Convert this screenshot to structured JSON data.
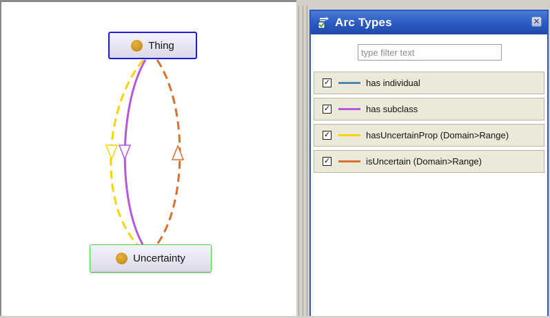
{
  "graph": {
    "nodes": {
      "thing": {
        "label": "Thing",
        "icon": "class-circle-icon"
      },
      "uncertainty": {
        "label": "Uncertainty",
        "icon": "class-circle-icon"
      }
    },
    "colors": {
      "node_dot": "#d4a029",
      "thing_border": "#1a1ad6",
      "uncertainty_border": "#4fd04f"
    }
  },
  "arc_panel": {
    "title": "Arc Types",
    "title_icon": "arc-types-icon",
    "close_icon": "close-icon",
    "filter_placeholder": "type filter text",
    "header_color": "#2e5cc4",
    "items": [
      {
        "label": "has individual",
        "color": "#4a86b8",
        "checked": true
      },
      {
        "label": "has subclass",
        "color": "#b657d8",
        "checked": true
      },
      {
        "label": "hasUncertainProp (Domain>Range)",
        "color": "#f5d400",
        "checked": true
      },
      {
        "label": "isUncertain (Domain>Range)",
        "color": "#d8702c",
        "checked": true
      }
    ]
  }
}
